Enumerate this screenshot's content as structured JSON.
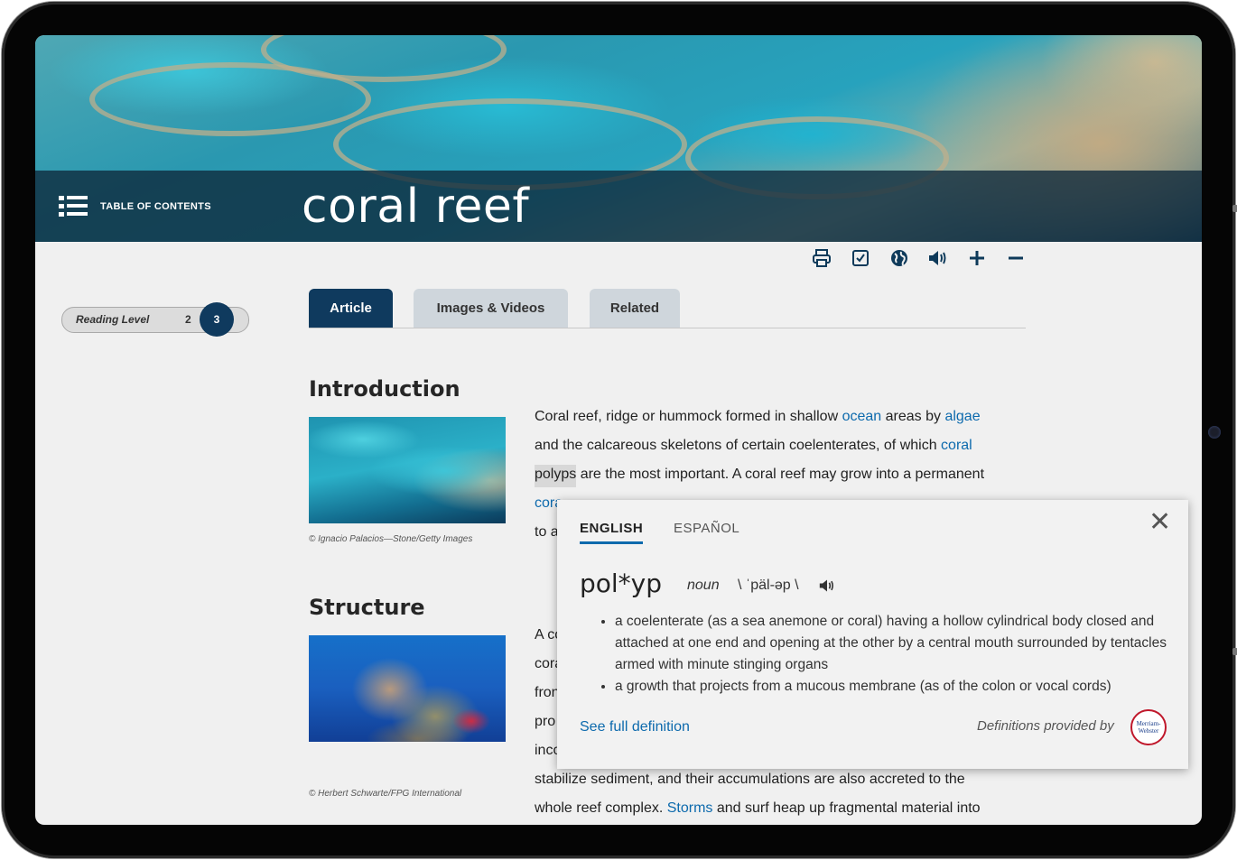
{
  "header": {
    "toc_label": "TABLE OF CONTENTS",
    "title": "coral reef"
  },
  "toolbar": {
    "icons": [
      "print-icon",
      "checklist-icon",
      "globe-icon",
      "speaker-icon",
      "plus-icon",
      "minus-icon"
    ]
  },
  "reading_level": {
    "label": "Reading Level",
    "levels": [
      "2",
      "3"
    ],
    "selected": "3"
  },
  "tabs": [
    {
      "label": "Article",
      "active": true
    },
    {
      "label": "Images & Videos",
      "active": false
    },
    {
      "label": "Related",
      "active": false
    }
  ],
  "sections": {
    "introduction": {
      "heading": "Introduction",
      "credit": "© Ignacio Palacios—Stone/Getty Images",
      "line1": {
        "a": "Coral reef, ridge or hummock formed in shallow ",
        "link1": "ocean",
        "b": " areas by ",
        "link2": "algae"
      },
      "line2": {
        "a": "and the calcareous skeletons of certain coelenterates, of which ",
        "link": "coral"
      },
      "line3": {
        "highlight": "polyps",
        "a": " are the most important. A coral reef may grow into a permanent"
      },
      "line4": {
        "link": "cora"
      },
      "line5": {
        "a": "to a"
      }
    },
    "structure": {
      "heading": "Structure",
      "credit": "© Herbert Schwarte/FPG International",
      "partial_lines": [
        "A co",
        "cora",
        "fron",
        "pro",
        "inco"
      ],
      "line6": "stabilize sediment, and their accumulations are also accreted to the",
      "line7": {
        "a": "whole reef complex. ",
        "link": "Storms",
        "b": " and surf heap up fragmental material into"
      }
    }
  },
  "popup": {
    "tab_english": "ENGLISH",
    "tab_spanish": "ESPAÑOL",
    "close": "✕",
    "headword": "pol*yp",
    "pos": "noun",
    "pronunciation": "\\ ˈpäl-əp \\",
    "definitions": [
      "a coelenterate (as a sea anemone or coral) having a hollow cylindrical body closed and attached at one end and opening at the other by a central mouth surrounded by tentacles armed with minute stinging organs",
      "a growth that projects from a mucous membrane (as of the colon or vocal cords)"
    ],
    "see_full": "See full definition",
    "provided_by": "Definitions provided by",
    "logo_text": "Merriam-Webster"
  },
  "colors": {
    "accent": "#0f3a5e",
    "link": "#0d6aad",
    "tab_inactive": "#cfd6dc",
    "background": "#f0f0f0"
  }
}
